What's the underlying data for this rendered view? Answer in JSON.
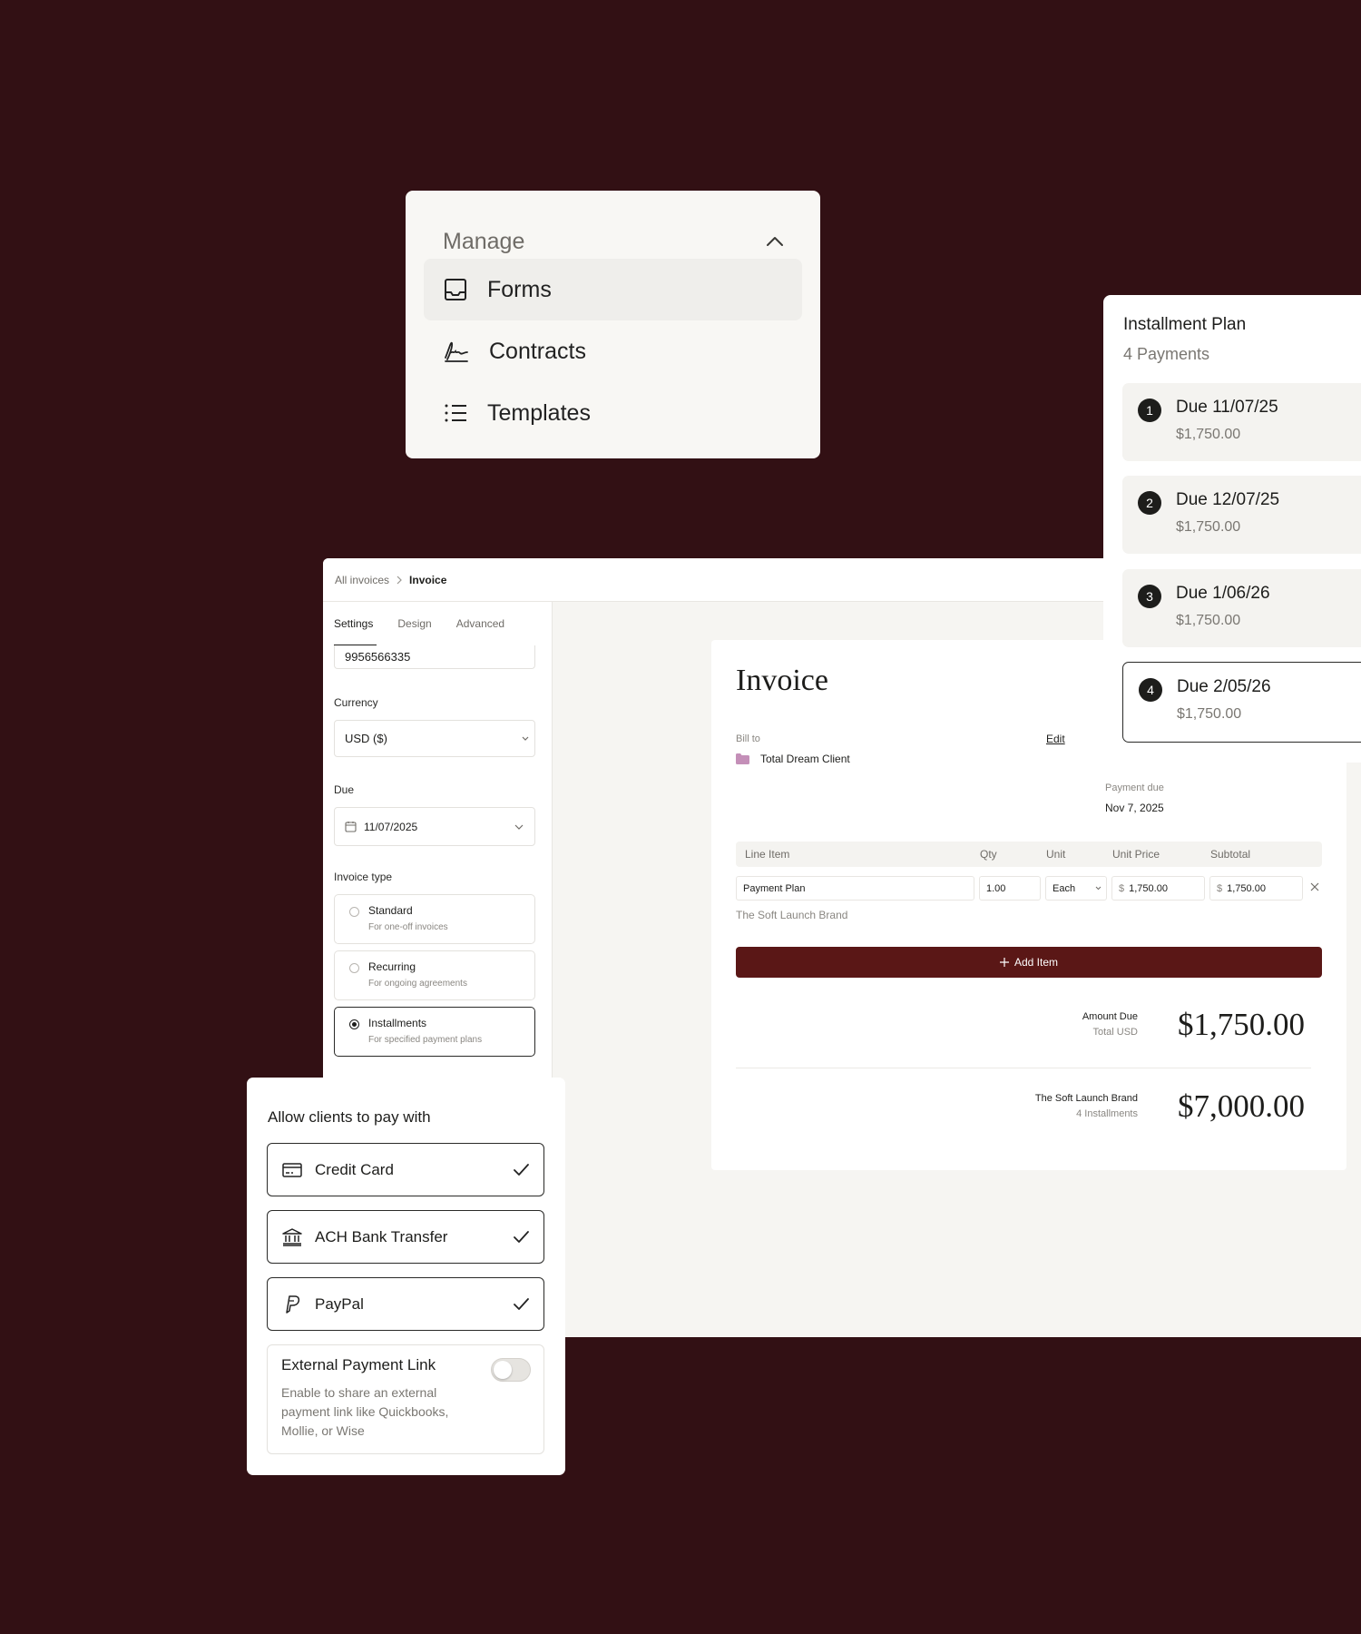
{
  "manage": {
    "title": "Manage",
    "items": [
      {
        "label": "Forms",
        "icon": "inbox-icon",
        "active": true
      },
      {
        "label": "Contracts",
        "icon": "signature-icon",
        "active": false
      },
      {
        "label": "Templates",
        "icon": "list-icon",
        "active": false
      }
    ]
  },
  "breadcrumb": {
    "parent": "All invoices",
    "current": "Invoice"
  },
  "settings": {
    "tabs": [
      "Settings",
      "Design",
      "Advanced"
    ],
    "phone_value": "9956566335",
    "currency_label": "Currency",
    "currency_value": "USD ($)",
    "due_label": "Due",
    "due_value": "11/07/2025",
    "invoice_type_label": "Invoice type",
    "types": [
      {
        "title": "Standard",
        "sub": "For one-off invoices",
        "selected": false
      },
      {
        "title": "Recurring",
        "sub": "For ongoing agreements",
        "selected": false
      },
      {
        "title": "Installments",
        "sub": "For specified payment plans",
        "selected": true
      }
    ]
  },
  "invoice": {
    "title": "Invoice",
    "bill_to_label": "Bill to",
    "edit_label": "Edit",
    "client": "Total Dream Client",
    "payment_due_label": "Payment due",
    "payment_due_value": "Nov 7, 2025",
    "columns": [
      "Line Item",
      "Qty",
      "Unit",
      "Unit Price",
      "Subtotal"
    ],
    "row": {
      "item": "Payment Plan",
      "qty": "1.00",
      "unit": "Each",
      "unit_price": "1,750.00",
      "subtotal": "1,750.00",
      "currency_symbol": "$",
      "description": "The Soft Launch Brand"
    },
    "add_item_label": "Add Item",
    "amount_due_label": "Amount Due",
    "amount_due_sub": "Total USD",
    "amount_due_value": "$1,750.00",
    "total_label": "The Soft Launch Brand",
    "total_sub": "4 Installments",
    "total_value": "$7,000.00"
  },
  "plan": {
    "title": "Installment Plan",
    "subtitle": "4 Payments",
    "installments": [
      {
        "num": "1",
        "due": "Due 11/07/25",
        "amount": "$1,750.00",
        "selected": false
      },
      {
        "num": "2",
        "due": "Due 12/07/25",
        "amount": "$1,750.00",
        "selected": false
      },
      {
        "num": "3",
        "due": "Due 1/06/26",
        "amount": "$1,750.00",
        "selected": false
      },
      {
        "num": "4",
        "due": "Due 2/05/26",
        "amount": "$1,750.00",
        "selected": true
      }
    ]
  },
  "payment": {
    "title": "Allow clients to pay with",
    "methods": [
      {
        "label": "Credit Card",
        "icon": "credit-card-icon",
        "checked": true
      },
      {
        "label": "ACH Bank Transfer",
        "icon": "bank-icon",
        "checked": true
      },
      {
        "label": "PayPal",
        "icon": "paypal-icon",
        "checked": true
      }
    ],
    "external_title": "External Payment Link",
    "external_desc": "Enable to share an external payment link like Quickbooks, Mollie, or Wise",
    "external_enabled": false
  },
  "colors": {
    "background": "#321014",
    "accent": "#5a1716",
    "folder": "#c48fb8"
  }
}
